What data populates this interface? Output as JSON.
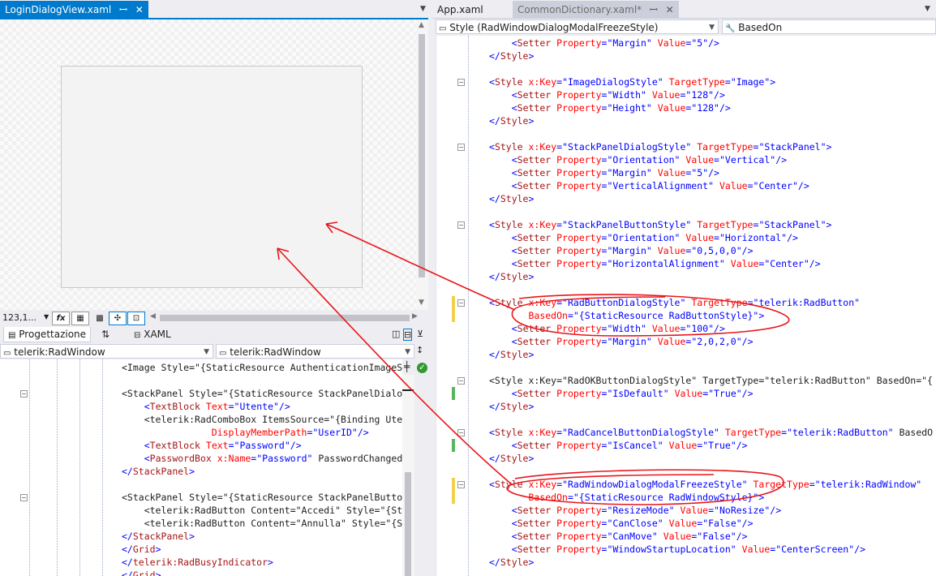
{
  "left_tabs": [
    {
      "label": "LoginDialogView.xaml",
      "pin": "ꟷ",
      "close": "✕"
    }
  ],
  "right_tabs": [
    {
      "label": "App.xaml"
    },
    {
      "label": "CommonDictionary.xaml*",
      "pin": "ꟷ",
      "close": "✕"
    }
  ],
  "designer": {
    "zoom": "123,1...",
    "view_tabs": {
      "design": "Progettazione",
      "swap": "⇅",
      "xaml": "XAML"
    },
    "left_combo": "telerik:RadWindow",
    "right_combo": "telerik:RadWindow"
  },
  "right_editor": {
    "type_combo": "Style (RadWindowDialogModalFreezeStyle)",
    "member_combo": "BasedOn"
  },
  "left_code": [
    "<Image Style=\"{StaticResource AuthenticationImageS",
    "",
    "<StackPanel Style=\"{StaticResource StackPanelDialo",
    "    <TextBlock Text=\"Utente\"/>",
    "    <telerik:RadComboBox ItemsSource=\"{Binding Ute",
    "                DisplayMemberPath=\"UserID\"/>",
    "    <TextBlock Text=\"Password\"/>",
    "    <PasswordBox x:Name=\"Password\" PasswordChanged",
    "</StackPanel>",
    "",
    "<StackPanel Style=\"{StaticResource StackPanelButto",
    "    <telerik:RadButton Content=\"Accedi\" Style=\"{St",
    "    <telerik:RadButton Content=\"Annulla\" Style=\"{S",
    "</StackPanel>",
    "</Grid>",
    "</telerik:RadBusyIndicator>",
    "</Grid>"
  ],
  "right_code": [
    "    <Setter Property=\"Margin\" Value=\"5\"/>",
    "</Style>",
    "",
    "<Style x:Key=\"ImageDialogStyle\" TargetType=\"Image\">",
    "    <Setter Property=\"Width\" Value=\"128\"/>",
    "    <Setter Property=\"Height\" Value=\"128\"/>",
    "</Style>",
    "",
    "<Style x:Key=\"StackPanelDialogStyle\" TargetType=\"StackPanel\">",
    "    <Setter Property=\"Orientation\" Value=\"Vertical\"/>",
    "    <Setter Property=\"Margin\" Value=\"5\"/>",
    "    <Setter Property=\"VerticalAlignment\" Value=\"Center\"/>",
    "</Style>",
    "",
    "<Style x:Key=\"StackPanelButtonStyle\" TargetType=\"StackPanel\">",
    "    <Setter Property=\"Orientation\" Value=\"Horizontal\"/>",
    "    <Setter Property=\"Margin\" Value=\"0,5,0,0\"/>",
    "    <Setter Property=\"HorizontalAlignment\" Value=\"Center\"/>",
    "</Style>",
    "",
    "<Style x:Key=\"RadButtonDialogStyle\" TargetType=\"telerik:RadButton\"",
    "       BasedOn=\"{StaticResource RadButtonStyle}\">",
    "    <Setter Property=\"Width\" Value=\"100\"/>",
    "    <Setter Property=\"Margin\" Value=\"2,0,2,0\"/>",
    "</Style>",
    "",
    "<Style x:Key=\"RadOKButtonDialogStyle\" TargetType=\"telerik:RadButton\" BasedOn=\"{",
    "    <Setter Property=\"IsDefault\" Value=\"True\"/>",
    "</Style>",
    "",
    "<Style x:Key=\"RadCancelButtonDialogStyle\" TargetType=\"telerik:RadButton\" BasedO",
    "    <Setter Property=\"IsCancel\" Value=\"True\"/>",
    "</Style>",
    "",
    "<Style x:Key=\"RadWindowDialogModalFreezeStyle\" TargetType=\"telerik:RadWindow\"",
    "       BasedOn=\"{StaticResource RadWindowStyle}\">",
    "    <Setter Property=\"ResizeMode\" Value=\"NoResize\"/>",
    "    <Setter Property=\"CanClose\" Value=\"False\"/>",
    "    <Setter Property=\"CanMove\" Value=\"False\"/>",
    "    <Setter Property=\"WindowStartupLocation\" Value=\"CenterScreen\"/>",
    "</Style>"
  ],
  "colors": {
    "accent": "#007acc",
    "annotation": "#e8161b",
    "tag": "#a31515",
    "attribute": "#ff0000",
    "value": "#0000ff",
    "change_saved": "#57b65d",
    "change_unsaved": "#f2d04b"
  },
  "icons": [
    "pin-icon",
    "close-icon",
    "formula-icon",
    "grid-icon",
    "snap-icon",
    "zoom-fit-icon",
    "check-icon",
    "fold-icon"
  ]
}
